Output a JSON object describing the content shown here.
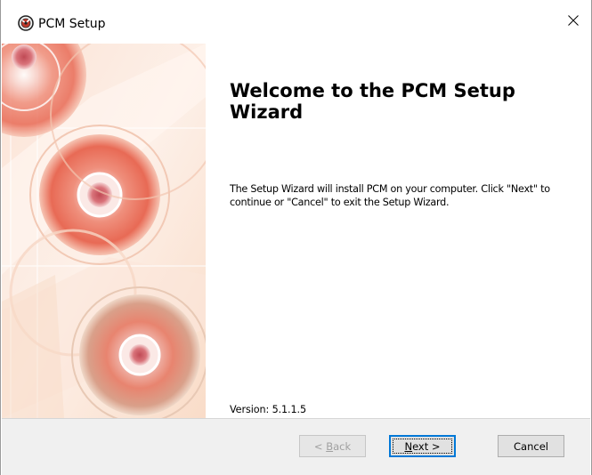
{
  "window": {
    "title": "PCM Setup",
    "close_symbol": "×"
  },
  "icons": {
    "app": "pcm-setup-icon",
    "close": "close-icon"
  },
  "content": {
    "heading": "Welcome to the PCM Setup Wizard",
    "description": "The Setup Wizard will install PCM on your computer.  Click \"Next\" to continue or \"Cancel\" to exit the Setup Wizard.",
    "version": "Version: 5.1.1.5"
  },
  "buttons": {
    "back": {
      "prefix": "< ",
      "mnemonic": "B",
      "rest": "ack",
      "enabled": false
    },
    "next": {
      "mnemonic": "N",
      "rest": "ext >",
      "enabled": true,
      "focused": true
    },
    "cancel": {
      "label": "Cancel",
      "enabled": true
    }
  },
  "colors": {
    "focus_border": "#0078d7",
    "footer_bg": "#f0f0f0",
    "disabled_text": "#a0a0a0"
  }
}
